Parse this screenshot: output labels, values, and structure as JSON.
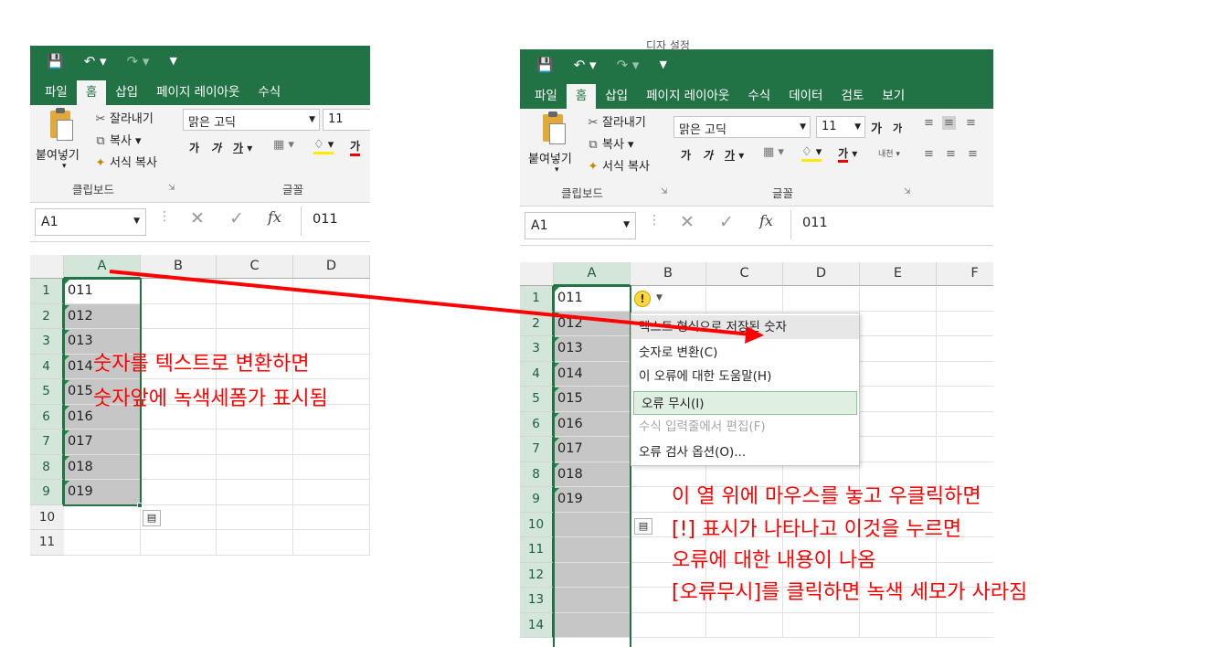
{
  "left_excel": {
    "tabs": [
      "파일",
      "홈",
      "삽입",
      "페이지 레이아웃",
      "수식"
    ],
    "active_tab": "홈",
    "clipboard": {
      "paste": "붙여넣기",
      "cut": "잘라내기",
      "copy": "복사",
      "format_painter": "서식 복사",
      "group": "클립보드"
    },
    "font": {
      "name": "맑은 고딕",
      "size": "11",
      "group": "글꼴",
      "bold": "가",
      "italic": "가",
      "underline": "가"
    },
    "name_box": "A1",
    "formula_value": "011",
    "columns": [
      "A",
      "B",
      "C",
      "D"
    ],
    "rows": [
      "1",
      "2",
      "3",
      "4",
      "5",
      "6",
      "7",
      "8",
      "9",
      "10",
      "11"
    ],
    "cells_a": [
      "011",
      "012",
      "013",
      "014",
      "015",
      "016",
      "017",
      "018",
      "019"
    ]
  },
  "right_excel": {
    "title_fragment": "디자 설정",
    "tabs": [
      "파일",
      "홈",
      "삽입",
      "페이지 레이아웃",
      "수식",
      "데이터",
      "검토",
      "보기"
    ],
    "active_tab": "홈",
    "clipboard": {
      "paste": "붙여넣기",
      "cut": "잘라내기",
      "copy": "복사",
      "format_painter": "서식 복사",
      "group": "클립보드"
    },
    "font": {
      "name": "맑은 고딕",
      "size": "11",
      "group": "글꼴",
      "grow": "가",
      "shrink": "가",
      "bold": "가",
      "italic": "가",
      "underline": "가",
      "phonetic": "내천"
    },
    "name_box": "A1",
    "formula_value": "011",
    "columns": [
      "A",
      "B",
      "C",
      "D",
      "E",
      "F"
    ],
    "rows": [
      "1",
      "2",
      "3",
      "4",
      "5",
      "6",
      "7",
      "8",
      "9",
      "10",
      "11",
      "12",
      "13",
      "14"
    ],
    "cells_a": [
      "011",
      "012",
      "013",
      "014",
      "015",
      "016",
      "017",
      "018",
      "019"
    ],
    "error_menu": {
      "header": "텍스트 형식으로 저장된 숫자",
      "items": [
        "숫자로 변환(C)",
        "이 오류에 대한 도움말(H)",
        "오류 무시(I)",
        "수식 입력줄에서 편집(F)",
        "오류 검사 옵션(O)..."
      ]
    },
    "warning_symbol": "!"
  },
  "annotations": {
    "left": [
      "숫자를 텍스트로 변환하면",
      "숫자앞에 녹색세폼가 표시됨"
    ],
    "right": [
      "이 열 위에 마우스를 놓고 우클릭하면",
      "[!] 표시가 나타나고 이것을 누르면",
      "오류에 대한 내용이 나옴",
      "[오류무시]를 클릭하면 녹색 세모가 사라짐"
    ]
  },
  "colors": {
    "excel_green": "#217346",
    "annotation_red": "#ff0000",
    "selection_gray": "#c6c6c6",
    "error_triangle": "#1b8a3c"
  }
}
